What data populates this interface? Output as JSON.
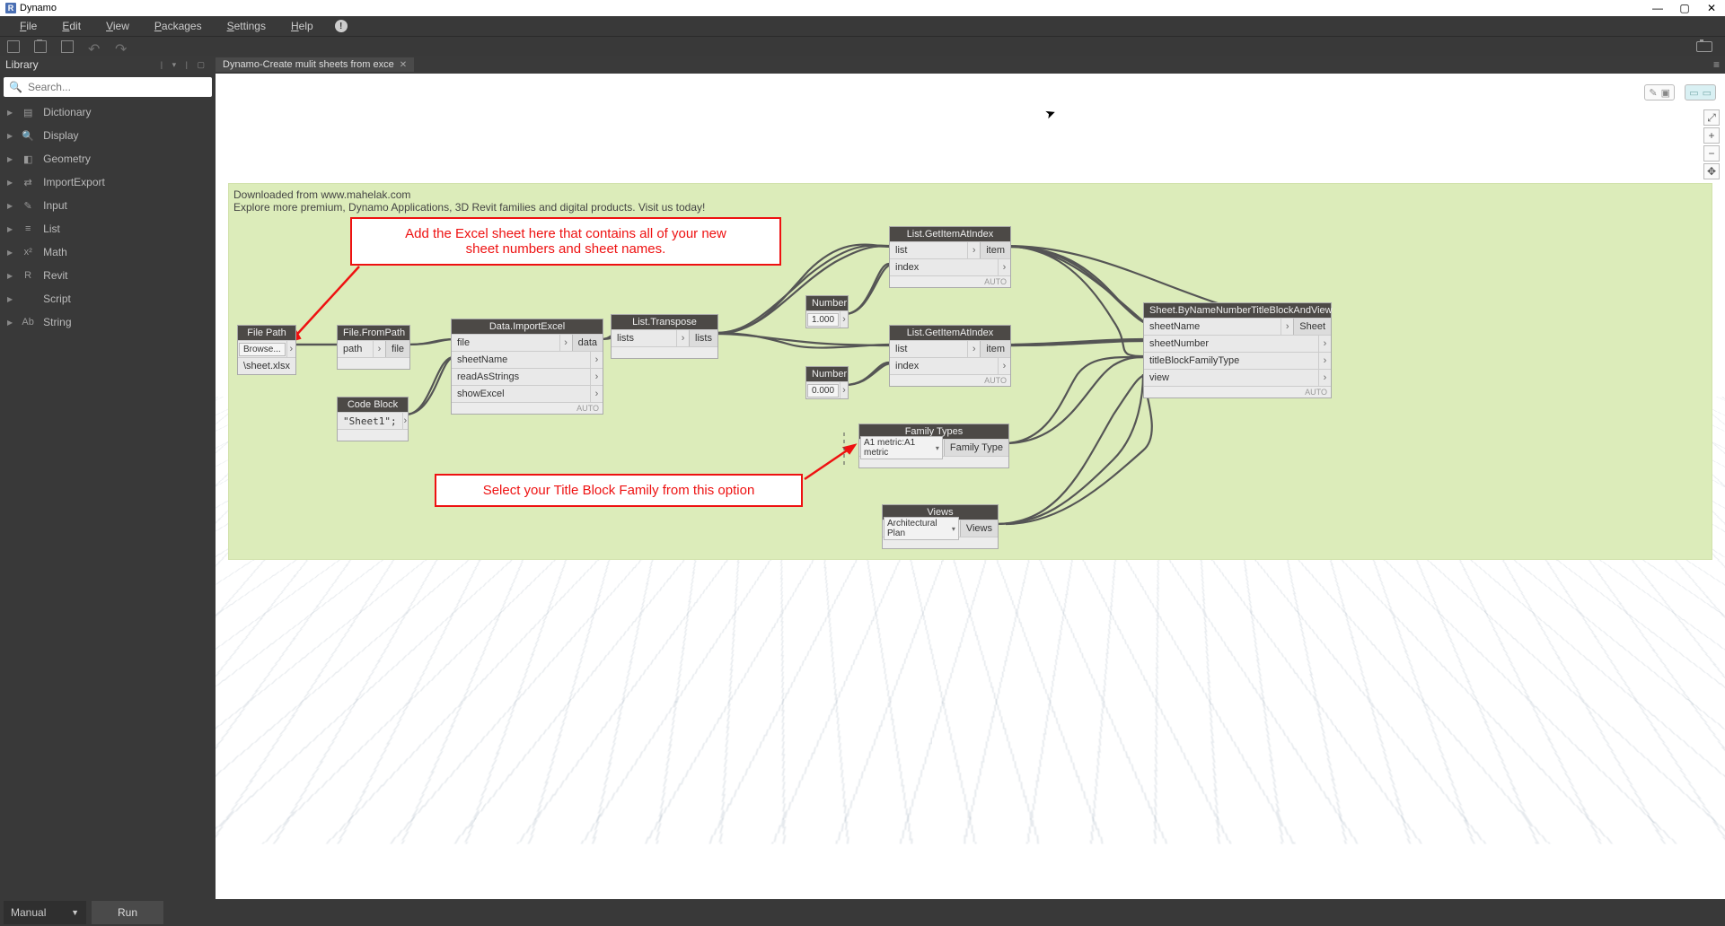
{
  "titlebar": {
    "app_letter": "R",
    "title": "Dynamo"
  },
  "menubar": {
    "items": [
      "File",
      "Edit",
      "View",
      "Packages",
      "Settings",
      "Help"
    ]
  },
  "librow": {
    "title": "Library",
    "tab": "Dynamo-Create mulit sheets from exce"
  },
  "search": {
    "placeholder": "Search..."
  },
  "sidebar": {
    "cats": [
      {
        "icon": "▤",
        "label": "Dictionary"
      },
      {
        "icon": "🔍",
        "label": "Display"
      },
      {
        "icon": "◧",
        "label": "Geometry"
      },
      {
        "icon": "⇄",
        "label": "ImportExport"
      },
      {
        "icon": "✎",
        "label": "Input"
      },
      {
        "icon": "≡",
        "label": "List"
      },
      {
        "icon": "x²",
        "label": "Math"
      },
      {
        "icon": "R",
        "label": "Revit"
      },
      {
        "icon": "</>",
        "label": "Script"
      },
      {
        "icon": "Ab",
        "label": "String"
      }
    ]
  },
  "green": {
    "line1": "Downloaded from www.mahelak.com",
    "line2": "Explore more premium, Dynamo Applications, 3D Revit families and digital products. Visit us today!"
  },
  "annot1": {
    "l1": "Add the Excel sheet here that contains all of your new",
    "l2": "sheet numbers and sheet names."
  },
  "annot2": "Select your Title Block Family from this option",
  "nodes": {
    "filepath": {
      "title": "File Path",
      "browse": "Browse...",
      "value": "\\sheet.xlsx"
    },
    "filefrom": {
      "title": "File.FromPath",
      "in": "path",
      "out": "file"
    },
    "codeblock": {
      "title": "Code Block",
      "code": "\"Sheet1\";"
    },
    "importexcel": {
      "title": "Data.ImportExcel",
      "ins": [
        "file",
        "sheetName",
        "readAsStrings",
        "showExcel"
      ],
      "out": "data",
      "foot": "AUTO"
    },
    "transpose": {
      "title": "List.Transpose",
      "in": "lists",
      "out": "lists"
    },
    "num1": {
      "title": "Number",
      "val": "1.000"
    },
    "num0": {
      "title": "Number",
      "val": "0.000"
    },
    "getidx": {
      "title": "List.GetItemAtIndex",
      "ins": [
        "list",
        "index"
      ],
      "out": "item",
      "foot": "AUTO"
    },
    "famtypes": {
      "title": "Family Types",
      "val": "A1 metric:A1 metric",
      "out": "Family Type"
    },
    "views": {
      "title": "Views",
      "val": "Architectural Plan",
      "out": "Views"
    },
    "sheet": {
      "title": "Sheet.ByNameNumberTitleBlockAndView",
      "ins": [
        "sheetName",
        "sheetNumber",
        "titleBlockFamilyType",
        "view"
      ],
      "out": "Sheet",
      "foot": "AUTO"
    }
  },
  "bottom": {
    "mode": "Manual",
    "run": "Run"
  }
}
